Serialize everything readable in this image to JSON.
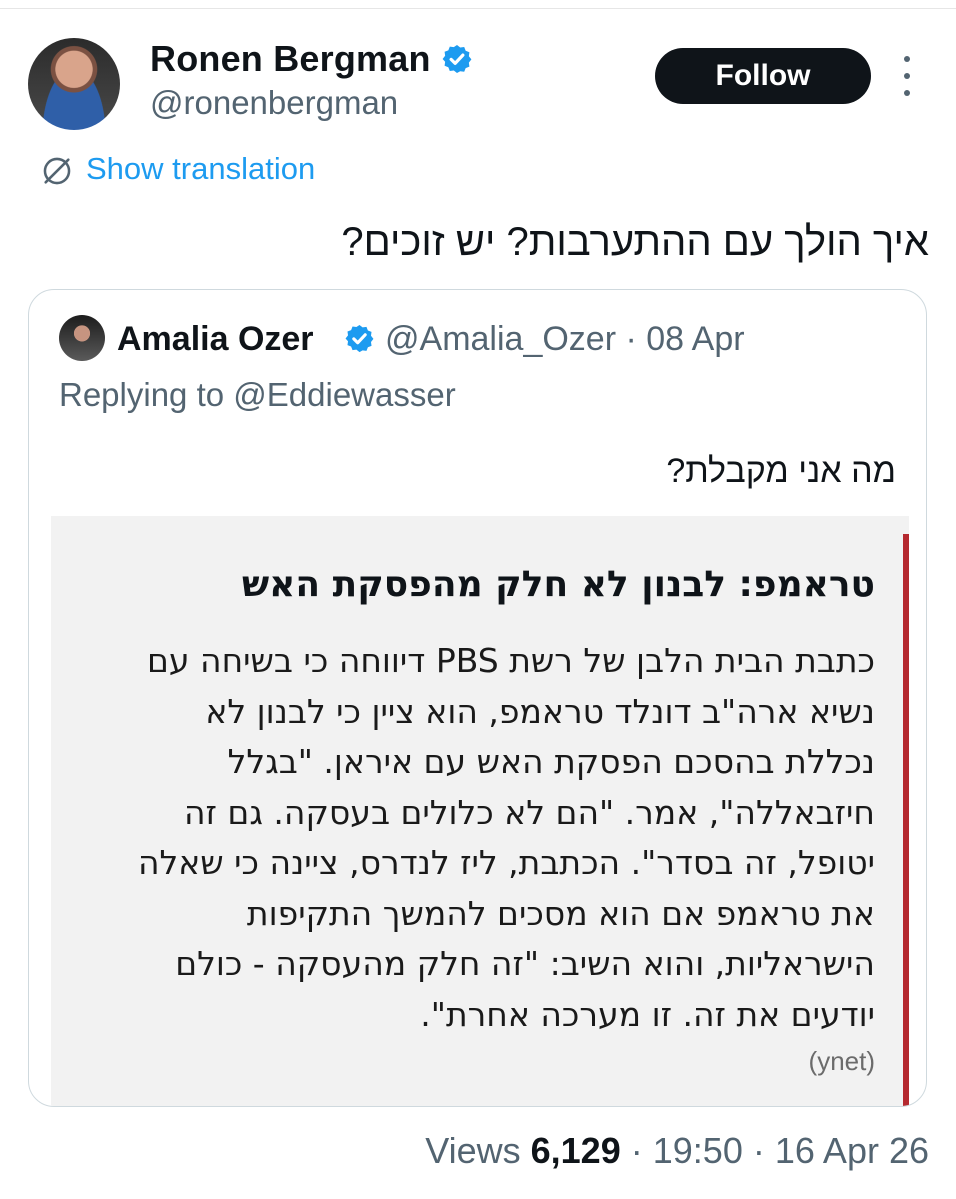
{
  "post": {
    "author": {
      "name": "Ronen Bergman",
      "handle": "@ronenbergman",
      "verified": true
    },
    "follow_label": "Follow",
    "show_translation_label": "Show translation",
    "text": "איך הולך עם ההתערבות? יש זוכים?",
    "views_label": "Views",
    "views_count": "6,129",
    "time": "19:50",
    "date": "16 Apr 26",
    "separator": "·"
  },
  "quote": {
    "author": {
      "name": "Amalia Ozer",
      "handle": "@Amalia_Ozer",
      "verified": true
    },
    "date": "08 Apr",
    "replying_to": "Replying to @Eddiewasser",
    "text": "מה אני מקבלת?",
    "attached_image": {
      "title": "טראמפ: לבנון לא חלק מהפסקת האש",
      "body_lines": [
        "כתבת הבית הלבן של רשת PBS דיווחה כי בשיחה עם",
        "נשיא ארה\"ב דונלד טראמפ, הוא ציין כי לבנון לא",
        "נכללת בהסכם הפסקת האש עם איראן. \"בגלל",
        "חיזבאללה\", אמר. \"הם לא כלולים בעסקה. גם זה",
        "יטופל, זה בסדר\". הכתבת, ליז לנדרס, ציינה כי שאלה",
        "את טראמפ אם הוא מסכים להמשך התקיפות",
        "הישראליות, והוא השיב: \"זה חלק מהעסקה - כולם",
        "יודעים את זה. זו מערכה אחרת\"."
      ],
      "source": "(ynet)",
      "accent_color": "#b5292f"
    }
  },
  "colors": {
    "link": "#1d9bf0",
    "verified": "#1d9bf0",
    "muted": "#536471",
    "button_bg": "#0f1419"
  }
}
